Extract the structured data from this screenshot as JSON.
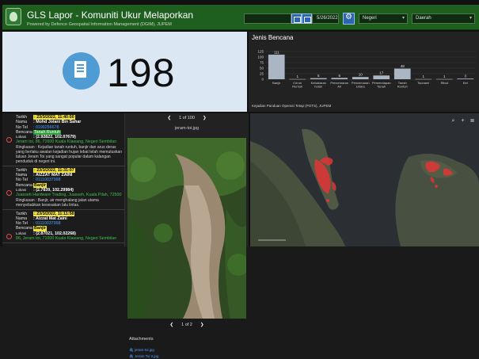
{
  "header": {
    "title": "GLS Lapor - Komuniti Ukur Melaporkan",
    "subtitle": "Powered by Defence Geospatial Information Management (DGIM), JUPEM",
    "date_value": "5/26/2022",
    "negeri_placeholder": "Negeri",
    "daerah_placeholder": "Daerah"
  },
  "indicator": {
    "value": "198"
  },
  "chart_panel": {
    "title": "Jenis Bencana",
    "footer": "Kejadian Panduan Operasi Tetap (POTS), JUPEM"
  },
  "chart_data": {
    "type": "bar",
    "categories": [
      "Banjir",
      "Cerun Runtuh",
      "Kebakaran hutan",
      "Pencemaran Air",
      "Pencemaran Udara",
      "Pemendapan Tanah",
      "Tanah Runtuh",
      "Tsunami",
      "Ribut",
      "Ket"
    ],
    "values": [
      111,
      1,
      5,
      6,
      10,
      17,
      48,
      1,
      1,
      3
    ],
    "ylim": [
      0,
      150
    ],
    "yticks": [
      0,
      25,
      50,
      75,
      100,
      125
    ],
    "bar_color": "#aab6c4"
  },
  "list": {
    "items": [
      {
        "tarikh_label": "Tarikh",
        "tarikh": ": 23/3/2022, 11:40:00",
        "nama_label": "Nama",
        "nama": ": Mohd Jolani Bin Sahar",
        "tel_label": "No Tel",
        "tel": ": 0199256678",
        "bencana_label": "Bencana",
        "bencana": "Tanah Runtuh",
        "lokasi_label": "Lokasi",
        "lokasi": ": (2.92822, 102.07679)",
        "address": "Jeram toi, 86, 71600 Kuala Klawang, Negeri Sembilan",
        "ringkasan": "Ringkasan : Kejadian tanah runtuh, banjir dan arus deras yang berlaku awalan kejadian hujan lebat telah memutuskan laluan Jeram Toi yang sangat popular dalam kalangan penduduk di negeri ini."
      },
      {
        "tarikh_label": "Tarikh",
        "tarikh": ": 23/3/2022, 11:31:07",
        "nama_label": "Nama",
        "nama": ": AIZZAT MAT ZAINI",
        "tel_label": "No Tel",
        "tel": ": 01110037998",
        "bencana_label": "Bencana",
        "bencana": "Banjir",
        "lokasi_label": "Lokasi",
        "lokasi": ": (2.7839, 102.29984)",
        "address": "Juasseh Hardware Trading, Juasseh, Kuala Pilah, 72500",
        "ringkasan": "Ringkasan : Banjir, air menghalang jalan utama menyebabkan kesesakan lalu lintas."
      },
      {
        "tarikh_label": "Tarikh",
        "tarikh": ": 23/3/2022, 11:11:58",
        "nama_label": "Nama",
        "nama": ": Aizzat Mat Zaini",
        "tel_label": "No Tel",
        "tel": ": 01110037998",
        "bencana_label": "Bencana",
        "bencana": "Banjir",
        "lokasi_label": "Lokasi",
        "lokasi": ": (2.87021, 102.02268)",
        "address": "86, Jeram toi, 71600 Kuala Klawang, Negeri Sembilan",
        "ringkasan": ""
      }
    ]
  },
  "media": {
    "pager_top": "1 of 100",
    "image_title": "jeram-toi.jpg",
    "pager_bottom": "1 of 2",
    "attachments_heading": "Attachments",
    "attachments": [
      "jeram-toi.jpg",
      "Jeram Toi 2.jpg"
    ]
  }
}
